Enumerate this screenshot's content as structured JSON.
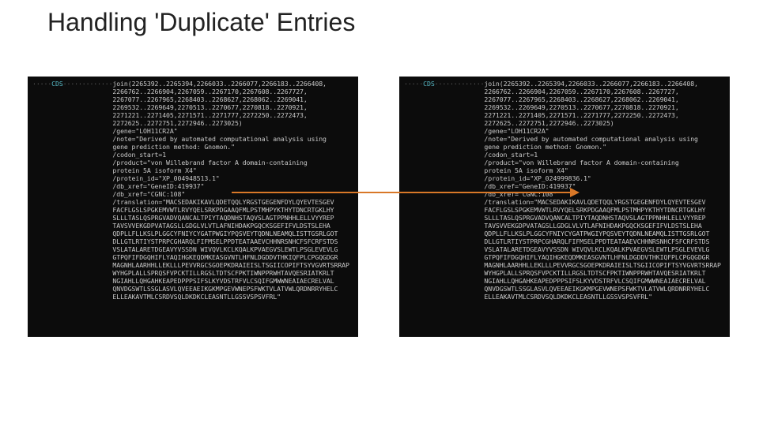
{
  "title": "Handling 'Duplicate' Entries",
  "left": {
    "feature": "CDS",
    "location": [
      "join(2265392..2265394,2266033..2266077,2266183..2266408,",
      "2266762..2266904,2267059..2267170,2267608..2267727,",
      "2267077..2267965,2268403..2268627,2268062..2269041,",
      "2269532..2269649,2270513..2270677,2270818..2270921,",
      "2271221..2271405,2271571..2271777,2272250..2272473,",
      "2272625..2272751,2272946..2273025)"
    ],
    "gene": "/gene=\"LOH11CR2A\"",
    "note": [
      "/note=\"Derived by automated computational analysis using",
      "gene prediction method: Gnomon.\""
    ],
    "codon_start": "/codon_start=1",
    "product": [
      "/product=\"von Willebrand factor A domain-containing",
      "protein 5A isoform X4\""
    ],
    "protein_id": "/protein_id=\"XP_004948513.1\"",
    "db_xref1": "/db_xref=\"GeneID:419937\"",
    "db_xref2": "/db_xref=\"CGNC:108\"",
    "translation": [
      "/translation=\"MACSEDAKIKAVLQDETQQLYRGSTGEGENFDYLQYEVTESGEV",
      "FACFLGSLSPGKEMVWTLRVYQELSRKPDGAAQFMLPSTMHPYKTHYTDNCRTGKLHY",
      "SLLLTASLQSPRGVADVQANCALTPIYTAQDNHSTAQVSLAGTPPNHHLELLVYYREP",
      "TAVSVVEKGDPVATAGSLLGDGLVLVTLAFNIHDAKPGQCKSGEFIFVLDSTSLEHA",
      "QDPLLFLLKSLPLGGCYFNIYCYGATPWGIYPQSVEYTQDNLNEAMQLISTTGSRLGOT",
      "DLLGTLRTIYSTPRPCGHARQLFIFMSELPPDTEATAAEVCHHNRSNHCFSFCRFSTDS",
      "VSLATALARETDGEAVYVSSDN WIVQVLKCLKQALKPVAEGVSLEWTLPSGLEVEVLG",
      "GTPQFIFDGQHIFLYAQIHGKEQDMKEASGVNTLHFNLDGDDVTHKIQFPLCPGQGDGR",
      "MAGNHLAARHHLLEKLLLPEVVRGCSGOEPKDRAIEISLTSGIICOPIFTSYVGVRTSRRAP",
      "WYHGPLALLSPRQSFVPCKTILLRGSLTDTSCFPKTIWNPPRWHTAVQESRIATKRLT",
      "NGIAHLLQHGAHKEAPEDPPPSIFSLKYVDSTRFVLCSQIFGMWWNEAIAECRELVAL",
      "QNVDGSWTLSSGLASVLQVEEAEIKGKMPGEVWNEPSFWKTVLATVWLQRDNRRYHELC",
      "ELLEAKAVTMLCSRDVSQLDKDKCLEASNTLLGSSVSPSVFRL\""
    ]
  },
  "right": {
    "feature": "CDS",
    "location": [
      "join(2265392..2265394,2266033..2266077,2266183..2266408,",
      "2266762..2266904,2267059..2267170,2267608..2267727,",
      "2267077..2267965,2268403..2268627,2268062..2269041,",
      "2269532..2269649,2270513..2270677,2270818..2270921,",
      "2271221..2271405,2271571..2271777,2272250..2272473,",
      "2272625..2272751,2272946..2273025)"
    ],
    "gene": "/gene=\"LOH11CR2A\"",
    "note": [
      "/note=\"Derived by automated computational analysis using",
      "gene prediction method: Gnomon.\""
    ],
    "codon_start": "/codon_start=1",
    "product": [
      "/product=\"von Willebrand factor A domain-containing",
      "protein 5A isoform X4\""
    ],
    "protein_id": "/protein_id=\"XP_024999836.1\"",
    "db_xref1": "/db_xref=\"GeneID:419937\"",
    "db_xref2": "/db_xref=\"CGNC:108\"",
    "translation": [
      "/translation=\"MACSEDAKIKAVLQDETQQLYRGSTGEGENFDYLQYEVTESGEV",
      "FACFLGSLSPGKEMVWTLRVYQELSRKPDGAAQFMLPSTMHPYKTHYTDNCRTGKLHY",
      "SLLLTASLQSPRGVADVQANCALTPIYTAQDNHSTAQVSLAGTPPNHHLELLVYYREP",
      "TAVSVVEKGDPVATAGSLLGDGLVLVTLAFNIHDAKPGQCKSGEFIFVLDSTSLEHA",
      "QDPLLFLLKSLPLGGCYFNIYCYGATPWGIYPQSVEYTQDNLNEAMQLISTTGSRLGOT",
      "DLLGTLRTIYSTPRPCGHARQLFIFMSELPPDTEATAAEVCHHNRSNHCFSFCRFSTDS",
      "VSLATALARETDGEAVYVSSDN WIVQVLKCLKQALKPVAEGVSLEWTLPSGLEVEVLG",
      "GTPQFIFDGQHIFLYAQIHGKEQDMKEASGVNTLHFNLDGDDVTHKIQFPLCPGQGDGR",
      "MAGNHLAARHHLLEKLLLPEVVRGCSGOEPKDRAIEISLTSGIICOPIFTSYVGVRTSRRAP",
      "WYHGPLALLSPRQSFVPCKTILLRGSLTDTSCFPKTIWNPPRWHTAVQESRIATKRLT",
      "NGIAHLLQHGAHKEAPEDPPPSIFSLKYVDSTRFVLCSQIFGMWWNEAIAECRELVAL",
      "QNVDGSWTLSSGLASVLQVEEAEIKGKMPGEVWNEPSFWKTVLATVWLQRDNRRYHELC",
      "ELLEAKAVTMLCSRDVSQLDKDKCLEASNTLLGSSVSPSVFRL\""
    ]
  }
}
